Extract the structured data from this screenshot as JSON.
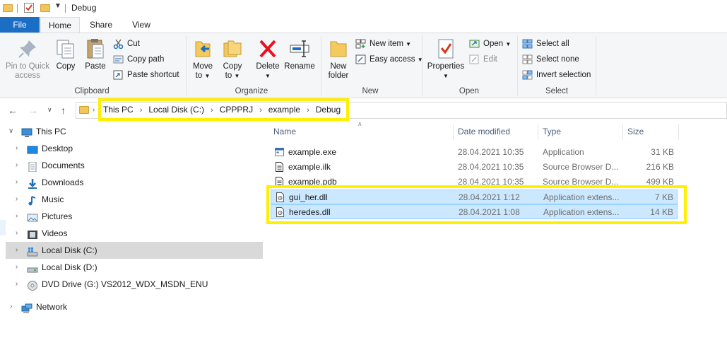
{
  "window": {
    "title": "Debug"
  },
  "tabs": {
    "file": "File",
    "home": "Home",
    "share": "Share",
    "view": "View"
  },
  "ribbon": {
    "clipboard": {
      "label": "Clipboard",
      "pin_line1": "Pin to Quick",
      "pin_line2": "access",
      "copy": "Copy",
      "paste": "Paste",
      "cut": "Cut",
      "copy_path": "Copy path",
      "paste_shortcut": "Paste shortcut"
    },
    "organize": {
      "label": "Organize",
      "move_to_line1": "Move",
      "move_to_line2": "to",
      "copy_to_line1": "Copy",
      "copy_to_line2": "to",
      "delete": "Delete",
      "rename": "Rename"
    },
    "new": {
      "label": "New",
      "new_folder_line1": "New",
      "new_folder_line2": "folder",
      "new_item": "New item",
      "easy_access": "Easy access"
    },
    "open": {
      "label": "Open",
      "properties": "Properties",
      "open": "Open",
      "edit": "Edit"
    },
    "select": {
      "label": "Select",
      "select_all": "Select all",
      "select_none": "Select none",
      "invert": "Invert selection"
    }
  },
  "address": {
    "crumbs": [
      "This PC",
      "Local Disk (C:)",
      "CPPPRJ",
      "example",
      "Debug"
    ]
  },
  "nav": {
    "this_pc": "This PC",
    "desktop": "Desktop",
    "documents": "Documents",
    "downloads": "Downloads",
    "music": "Music",
    "pictures": "Pictures",
    "videos": "Videos",
    "local_c": "Local Disk (C:)",
    "local_d": "Local Disk (D:)",
    "dvd": "DVD Drive (G:) VS2012_WDX_MSDN_ENU",
    "network": "Network"
  },
  "columns": {
    "name": "Name",
    "date": "Date modified",
    "type": "Type",
    "size": "Size"
  },
  "files": [
    {
      "name": "example.exe",
      "date": "28.04.2021 10:35",
      "type": "Application",
      "size": "31 KB",
      "selected": false
    },
    {
      "name": "example.ilk",
      "date": "28.04.2021 10:35",
      "type": "Source Browser D...",
      "size": "216 KB",
      "selected": false
    },
    {
      "name": "example.pdb",
      "date": "28.04.2021 10:35",
      "type": "Source Browser D...",
      "size": "499 KB",
      "selected": false
    },
    {
      "name": "gui_her.dll",
      "date": "28.04.2021 1:12",
      "type": "Application extens...",
      "size": "7 KB",
      "selected": true
    },
    {
      "name": "heredes.dll",
      "date": "28.04.2021 1:08",
      "type": "Application extens...",
      "size": "14 KB",
      "selected": true
    }
  ],
  "colors": {
    "accent": "#1a6fc4",
    "selection": "#cce8ff",
    "highlight": "#ffef00"
  }
}
